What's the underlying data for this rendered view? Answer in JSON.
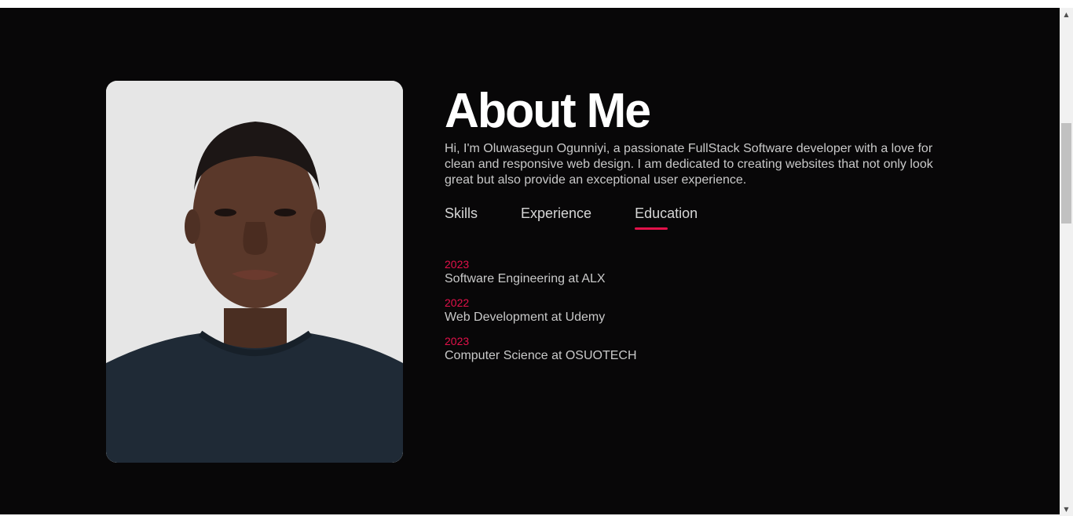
{
  "about": {
    "title": "About Me",
    "description": "Hi, I'm Oluwasegun Ogunniyi, a passionate FullStack Software developer with a love for clean and responsive web design. I am dedicated to creating websites that not only look great but also provide an exceptional user experience."
  },
  "tabs": [
    {
      "label": "Skills",
      "active": false
    },
    {
      "label": "Experience",
      "active": false
    },
    {
      "label": "Education",
      "active": true
    }
  ],
  "education": [
    {
      "year": "2023",
      "title": "Software Engineering at ALX"
    },
    {
      "year": "2022",
      "title": "Web Development at Udemy"
    },
    {
      "year": "2023",
      "title": "Computer Science at OSUOTECH"
    }
  ],
  "colors": {
    "background": "#080708",
    "accent": "#e3114a",
    "text": "#c9c9c9",
    "heading": "#ffffff"
  },
  "icons": {
    "scroll_up": "scroll-up-arrow-icon",
    "scroll_down": "scroll-down-arrow-icon"
  }
}
